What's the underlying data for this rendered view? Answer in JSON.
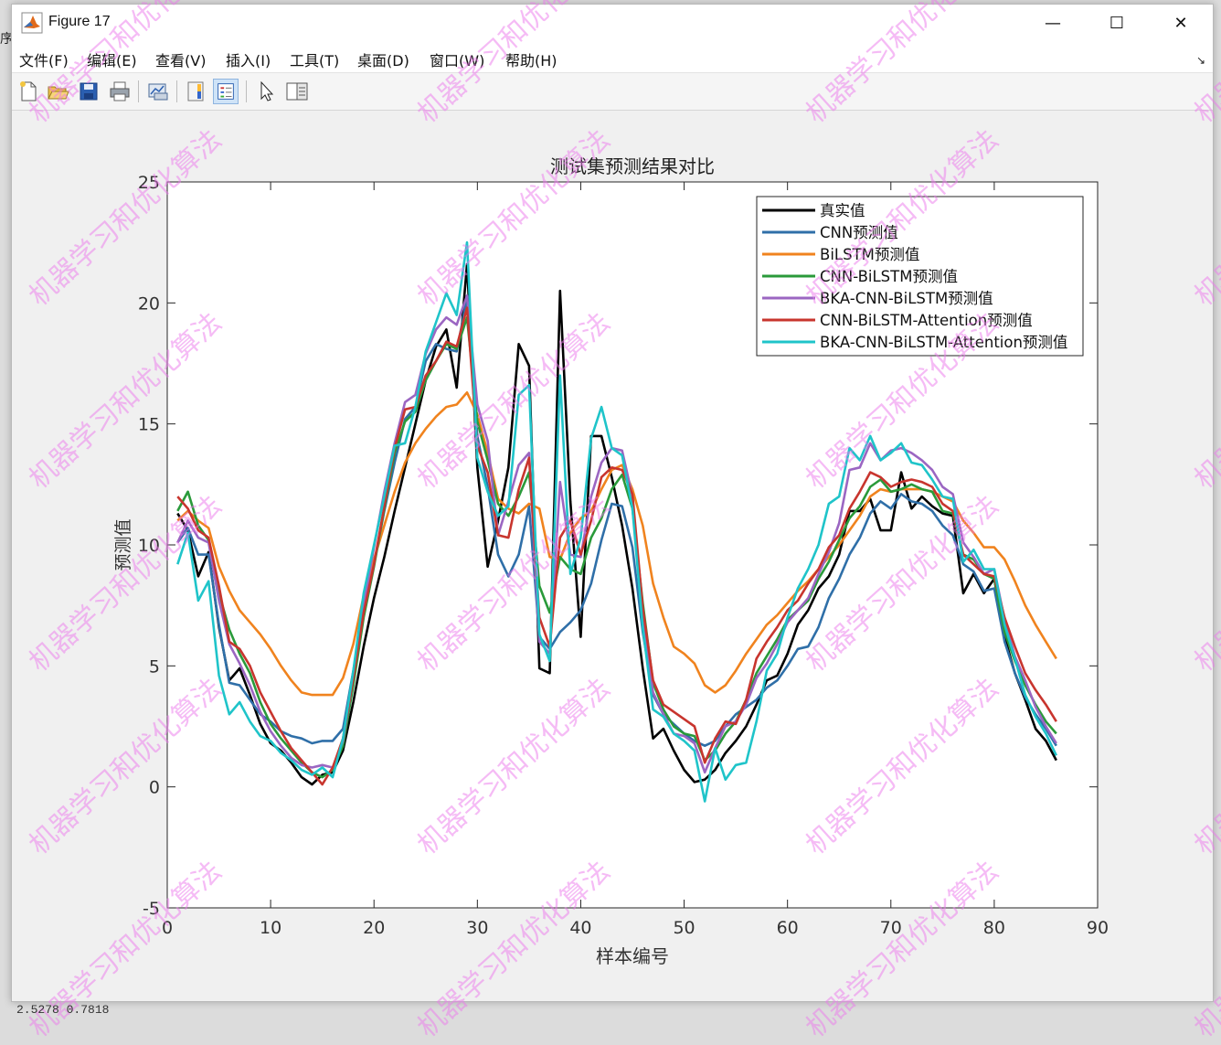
{
  "window": {
    "title": "Figure 17",
    "controls": {
      "minimize": "—",
      "maximize": "☐",
      "close": "✕"
    }
  },
  "menu": {
    "items": [
      "文件(F)",
      "编辑(E)",
      "查看(V)",
      "插入(I)",
      "工具(T)",
      "桌面(D)",
      "窗口(W)",
      "帮助(H)"
    ]
  },
  "toolbar": {
    "buttons": [
      {
        "icon": "new-figure-icon",
        "active": false
      },
      {
        "icon": "open-file-icon",
        "active": false
      },
      {
        "icon": "save-icon",
        "active": false
      },
      {
        "icon": "print-icon",
        "active": false
      },
      {
        "icon": "link-plot-icon",
        "active": false
      },
      {
        "icon": "insert-colorbar-icon",
        "active": false
      },
      {
        "icon": "insert-legend-icon",
        "active": true
      },
      {
        "icon": "edit-plot-pointer-icon",
        "active": false
      },
      {
        "icon": "property-inspector-icon",
        "active": false
      }
    ]
  },
  "watermark_text": "机器学习和优化算法",
  "bottom_readout": "2.5278          0.7818",
  "left_edge_char": "序",
  "chart_data": {
    "type": "line",
    "title": "测试集预测结果对比",
    "xlabel": "样本编号",
    "ylabel": "预测值",
    "xlim": [
      0,
      90
    ],
    "ylim": [
      -5,
      25
    ],
    "xticks": [
      0,
      10,
      20,
      30,
      40,
      50,
      60,
      70,
      80,
      90
    ],
    "yticks": [
      -5,
      0,
      5,
      10,
      15,
      20,
      25
    ],
    "legend_position": "top-right",
    "x": [
      1,
      2,
      3,
      4,
      5,
      6,
      7,
      8,
      9,
      10,
      11,
      12,
      13,
      14,
      15,
      16,
      17,
      18,
      19,
      20,
      21,
      22,
      23,
      24,
      25,
      26,
      27,
      28,
      29,
      30,
      31,
      32,
      33,
      34,
      35,
      36,
      37,
      38,
      39,
      40,
      41,
      42,
      43,
      44,
      45,
      46,
      47,
      48,
      49,
      50,
      51,
      52,
      53,
      54,
      55,
      56,
      57,
      58,
      59,
      60,
      61,
      62,
      63,
      64,
      65,
      66,
      67,
      68,
      69,
      70,
      71,
      72,
      73,
      74,
      75,
      76,
      77,
      78,
      79,
      80,
      81,
      82,
      83,
      84,
      85,
      86
    ],
    "series": [
      {
        "name": "真实值",
        "color": "#000000",
        "values": [
          11.3,
          10.6,
          8.7,
          9.7,
          6.6,
          4.4,
          4.9,
          3.8,
          2.6,
          1.8,
          1.5,
          1.0,
          0.4,
          0.1,
          0.5,
          0.6,
          1.5,
          3.5,
          5.8,
          7.8,
          9.5,
          11.4,
          13.2,
          15.0,
          16.8,
          18.2,
          18.9,
          16.5,
          21.6,
          13.2,
          9.1,
          11.0,
          13.2,
          18.3,
          17.4,
          4.9,
          4.7,
          20.5,
          11.8,
          6.2,
          14.5,
          14.5,
          12.8,
          10.8,
          8.2,
          4.9,
          2.0,
          2.4,
          1.5,
          0.7,
          0.2,
          0.3,
          0.7,
          1.4,
          1.9,
          2.5,
          3.4,
          4.4,
          4.6,
          5.5,
          6.7,
          7.3,
          8.2,
          8.7,
          9.6,
          11.4,
          11.4,
          11.9,
          10.6,
          10.6,
          13.0,
          11.5,
          12.0,
          11.6,
          11.3,
          11.2,
          8.0,
          8.8,
          8.0,
          8.6,
          6.2,
          4.7,
          3.6,
          2.4,
          1.9,
          1.1
        ]
      },
      {
        "name": "CNN预测值",
        "color": "#2f6fa8",
        "values": [
          10.1,
          10.7,
          9.6,
          9.6,
          6.7,
          4.3,
          4.2,
          3.6,
          3.0,
          2.7,
          2.3,
          2.1,
          2.0,
          1.8,
          1.9,
          1.9,
          2.4,
          4.8,
          7.2,
          9.2,
          11.4,
          13.4,
          15.2,
          15.7,
          17.6,
          18.3,
          18.1,
          18.0,
          20.2,
          14.5,
          12.4,
          9.6,
          8.7,
          9.6,
          11.6,
          6.2,
          5.7,
          6.4,
          6.8,
          7.3,
          8.4,
          10.2,
          11.7,
          11.6,
          9.9,
          6.4,
          3.8,
          3.0,
          2.6,
          2.2,
          1.9,
          1.7,
          1.9,
          2.5,
          3.0,
          3.3,
          3.6,
          4.1,
          4.4,
          5.0,
          5.7,
          5.8,
          6.6,
          7.8,
          8.6,
          9.6,
          10.3,
          11.3,
          11.8,
          11.5,
          12.1,
          11.8,
          11.7,
          11.4,
          10.8,
          10.4,
          9.2,
          8.9,
          8.1,
          8.2,
          6.0,
          4.7,
          3.7,
          3.0,
          2.4,
          1.7
        ]
      },
      {
        "name": "BiLSTM预测值",
        "color": "#f0831e",
        "values": [
          11.0,
          11.4,
          11.0,
          10.7,
          9.1,
          8.1,
          7.3,
          6.8,
          6.3,
          5.7,
          5.0,
          4.4,
          3.9,
          3.8,
          3.8,
          3.8,
          4.5,
          5.9,
          7.9,
          9.4,
          10.8,
          12.2,
          13.4,
          14.2,
          14.8,
          15.3,
          15.7,
          15.8,
          16.3,
          15.4,
          13.8,
          11.9,
          11.5,
          11.3,
          11.7,
          11.5,
          9.5,
          9.4,
          10.5,
          11.1,
          11.4,
          12.3,
          13.1,
          13.3,
          12.3,
          10.8,
          8.4,
          7.0,
          5.8,
          5.5,
          5.1,
          4.2,
          3.9,
          4.2,
          4.8,
          5.5,
          6.1,
          6.7,
          7.1,
          7.6,
          8.1,
          8.5,
          9.0,
          9.5,
          10.0,
          10.6,
          11.2,
          12.0,
          12.3,
          12.2,
          12.3,
          12.3,
          12.3,
          12.2,
          12.0,
          11.8,
          11.0,
          10.5,
          9.9,
          9.9,
          9.4,
          8.5,
          7.5,
          6.7,
          6.0,
          5.3
        ]
      },
      {
        "name": "CNN-BiLSTM预测值",
        "color": "#2a9a3a",
        "values": [
          11.4,
          12.2,
          10.8,
          10.2,
          8.0,
          6.5,
          5.5,
          4.7,
          3.5,
          2.6,
          2.0,
          1.5,
          1.0,
          0.6,
          0.4,
          0.7,
          1.7,
          4.2,
          7.0,
          9.1,
          11.5,
          13.8,
          15.1,
          15.5,
          16.8,
          17.6,
          18.3,
          18.1,
          19.4,
          15.1,
          13.5,
          11.7,
          11.2,
          12.0,
          13.0,
          8.3,
          7.2,
          9.5,
          9.0,
          8.8,
          10.3,
          11.1,
          12.3,
          12.9,
          11.5,
          7.6,
          4.3,
          3.2,
          2.5,
          2.2,
          2.1,
          1.1,
          1.5,
          2.2,
          2.7,
          3.6,
          4.7,
          5.4,
          6.1,
          6.9,
          7.3,
          7.7,
          8.6,
          9.3,
          10.2,
          11.1,
          11.6,
          12.4,
          12.7,
          12.2,
          12.3,
          12.5,
          12.3,
          12.2,
          11.4,
          11.3,
          9.6,
          9.4,
          8.8,
          8.6,
          6.4,
          5.2,
          4.2,
          3.4,
          2.7,
          2.2
        ]
      },
      {
        "name": "BKA-CNN-BiLSTM预测值",
        "color": "#9b66c2",
        "values": [
          10.1,
          11.0,
          10.3,
          10.1,
          7.7,
          5.9,
          5.1,
          4.2,
          3.1,
          2.3,
          1.7,
          1.2,
          0.9,
          0.8,
          0.9,
          0.8,
          1.9,
          4.5,
          7.5,
          9.9,
          12.2,
          14.2,
          15.9,
          16.2,
          17.9,
          18.9,
          19.4,
          19.1,
          20.3,
          15.8,
          14.3,
          10.4,
          11.8,
          13.3,
          13.8,
          6.0,
          5.5,
          12.6,
          9.6,
          9.5,
          12.0,
          13.4,
          14.0,
          13.9,
          12.0,
          6.9,
          3.9,
          3.0,
          2.2,
          2.1,
          1.8,
          0.6,
          1.6,
          2.5,
          2.7,
          3.4,
          4.5,
          5.1,
          5.9,
          6.8,
          7.3,
          7.8,
          8.8,
          9.7,
          10.9,
          13.1,
          13.2,
          14.2,
          13.5,
          13.9,
          14.0,
          13.8,
          13.5,
          13.1,
          12.4,
          12.1,
          10.1,
          9.5,
          8.8,
          9.0,
          6.9,
          5.4,
          4.4,
          3.3,
          2.5,
          1.8
        ]
      },
      {
        "name": "CNN-BiLSTM-Attention预测值",
        "color": "#c8352e",
        "values": [
          12.0,
          11.5,
          10.6,
          10.3,
          8.3,
          6.0,
          5.7,
          5.0,
          3.9,
          3.1,
          2.3,
          1.6,
          1.1,
          0.6,
          0.1,
          0.8,
          2.0,
          4.5,
          7.2,
          9.2,
          11.6,
          14.0,
          15.6,
          15.7,
          17.0,
          17.6,
          18.4,
          18.2,
          19.8,
          14.1,
          13.0,
          10.4,
          10.3,
          12.3,
          13.6,
          7.0,
          5.8,
          10.3,
          11.0,
          9.6,
          11.0,
          12.8,
          13.2,
          13.1,
          12.1,
          7.4,
          4.4,
          3.4,
          3.1,
          2.8,
          2.5,
          1.0,
          2.0,
          2.7,
          2.6,
          3.6,
          5.3,
          6.0,
          6.6,
          7.3,
          7.7,
          8.4,
          9.0,
          9.9,
          10.4,
          11.5,
          12.2,
          13.0,
          12.8,
          12.4,
          12.6,
          12.7,
          12.6,
          12.4,
          11.7,
          11.4,
          9.6,
          9.2,
          8.8,
          8.7,
          7.0,
          5.8,
          4.7,
          4.0,
          3.4,
          2.7
        ]
      },
      {
        "name": "BKA-CNN-BiLSTM-Attention预测值",
        "color": "#1fc4c9",
        "values": [
          9.2,
          10.5,
          7.7,
          8.5,
          4.6,
          3.0,
          3.5,
          2.7,
          2.1,
          1.9,
          1.4,
          1.1,
          0.7,
          0.5,
          0.8,
          0.4,
          2.0,
          4.8,
          8.0,
          10.0,
          12.0,
          14.1,
          14.2,
          15.7,
          18.0,
          19.2,
          20.4,
          19.5,
          22.5,
          13.6,
          12.2,
          11.2,
          11.6,
          16.2,
          16.6,
          6.3,
          5.2,
          17.0,
          8.8,
          10.3,
          14.4,
          15.7,
          14.0,
          13.7,
          11.5,
          6.6,
          3.2,
          2.9,
          2.2,
          1.9,
          1.5,
          -0.6,
          1.6,
          0.3,
          0.9,
          1.0,
          2.7,
          4.8,
          5.5,
          7.0,
          8.2,
          9.0,
          10.0,
          11.7,
          12.0,
          14.0,
          13.5,
          14.5,
          13.5,
          13.8,
          14.2,
          13.4,
          13.3,
          12.7,
          12.0,
          11.9,
          9.3,
          9.8,
          9.0,
          9.0,
          6.7,
          5.3,
          3.8,
          2.9,
          2.2,
          1.3
        ]
      }
    ]
  }
}
